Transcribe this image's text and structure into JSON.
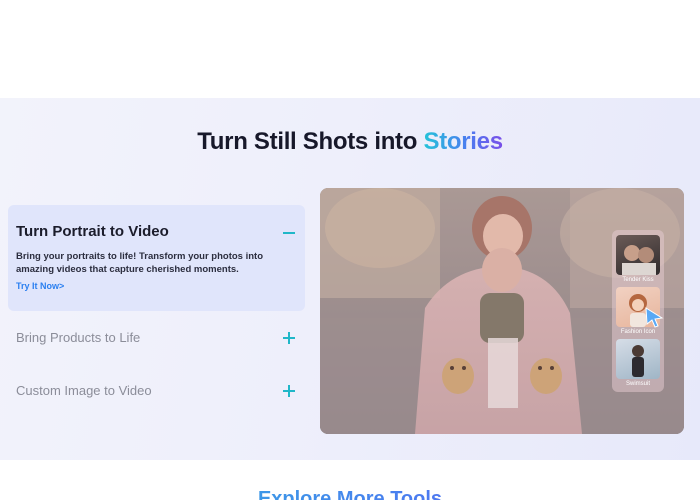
{
  "headline": {
    "prefix": "Turn Still Shots into",
    "accent": "Stories"
  },
  "accordion": {
    "active": {
      "title": "Turn Portrait to Video",
      "description": "Bring your portraits to life! Transform your photos into amazing videos that capture cherished moments.",
      "link": "Try It Now>"
    },
    "items": [
      {
        "label": "Bring Products to Life"
      },
      {
        "label": "Custom Image to Video"
      }
    ]
  },
  "preview": {
    "thumbnails": [
      {
        "label": "Tender Kiss"
      },
      {
        "label": "Fashion Icon"
      },
      {
        "label": "Swimsuit"
      }
    ]
  },
  "footer_heading": "Explore More Tools",
  "colors": {
    "accent_teal": "#20b7c8",
    "link_blue": "#2a7ff0",
    "active_bg": "#e0e5fb"
  },
  "icons": [
    "minus-icon",
    "plus-icon",
    "cursor-icon"
  ]
}
